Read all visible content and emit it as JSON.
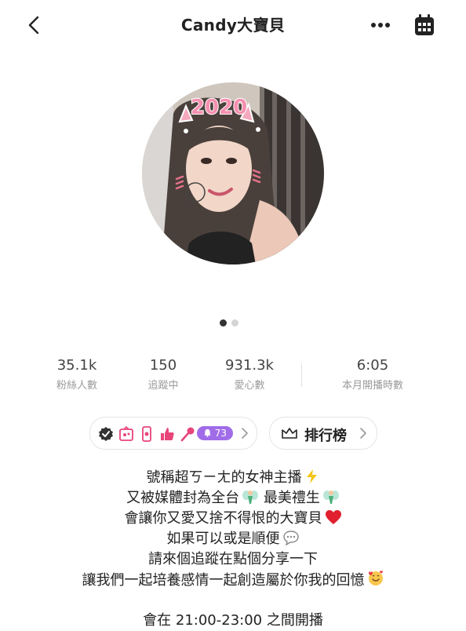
{
  "header": {
    "title": "Candy大寶貝",
    "icons": {
      "back": "chevron-left-icon",
      "more": "more-horizontal-icon",
      "calendar": "calendar-icon"
    }
  },
  "profile": {
    "avatar_text": "2020",
    "carousel": {
      "total": 2,
      "active": 1
    }
  },
  "stats": [
    {
      "value": "35.1k",
      "label": "粉絲人數"
    },
    {
      "value": "150",
      "label": "追蹤中"
    },
    {
      "value": "931.3k",
      "label": "愛心數"
    },
    {
      "value": "6:05",
      "label": "本月開播時數"
    }
  ],
  "badges": {
    "icons": [
      "verified-badge-icon",
      "gift-badge-icon",
      "phone-badge-icon",
      "thumbs-up-icon",
      "microphone-icon"
    ],
    "level": "73"
  },
  "leaderboard": {
    "label": "排行榜",
    "icon": "crown-icon"
  },
  "bio": {
    "lines": [
      "號稱超ㄎㄧㄤ的女神主播",
      "又被媒體封為全台",
      "最美禮生",
      "會讓你又愛又捨不得恨的大寶貝",
      "如果可以或是順便",
      "請來個追蹤在點個分享一下",
      "讓我們一起培養感情一起創造屬於你我的回憶",
      "會在 21:00-23:00 之間開播"
    ]
  },
  "colors": {
    "accent_purple": "#a06ce8",
    "badge_pink": "#e8457a",
    "dot_active": "#333333",
    "dot_inactive": "#d5d5d5",
    "text_secondary": "#9a9a9a"
  }
}
